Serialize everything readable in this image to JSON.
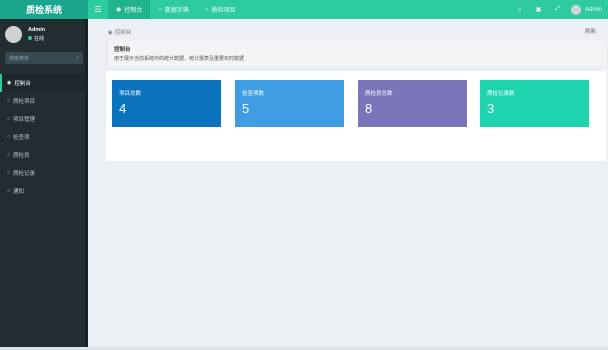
{
  "app": {
    "title": "质检系统"
  },
  "header": {
    "tabs": [
      {
        "label": "控制台",
        "active": true
      },
      {
        "label": "数据字典",
        "active": false
      },
      {
        "label": "质检项目",
        "active": false
      }
    ],
    "user": "Admin"
  },
  "sidebar": {
    "user_name": "Admin",
    "user_status": "在线",
    "search_placeholder": "搜索菜单",
    "items": [
      {
        "label": "控制台",
        "active": true
      },
      {
        "label": "质检项目",
        "active": false
      },
      {
        "label": "项目管理",
        "active": false
      },
      {
        "label": "检查项",
        "active": false
      },
      {
        "label": "质检员",
        "active": false
      },
      {
        "label": "质检记录",
        "active": false
      },
      {
        "label": "通知",
        "active": false
      }
    ]
  },
  "content": {
    "breadcrumb": "控制台",
    "refresh": "刷新",
    "callout_title": "控制台",
    "callout_desc": "用于展示当前系统中的统计数据、统计报表及重要实时数据",
    "cards": [
      {
        "label": "项目总数",
        "value": "4",
        "color": "#0c74bd"
      },
      {
        "label": "检查项数",
        "value": "5",
        "color": "#3f9ee3"
      },
      {
        "label": "质检员总数",
        "value": "8",
        "color": "#7a74b8"
      },
      {
        "label": "质检记录数",
        "value": "3",
        "color": "#1ed4ae"
      }
    ]
  }
}
